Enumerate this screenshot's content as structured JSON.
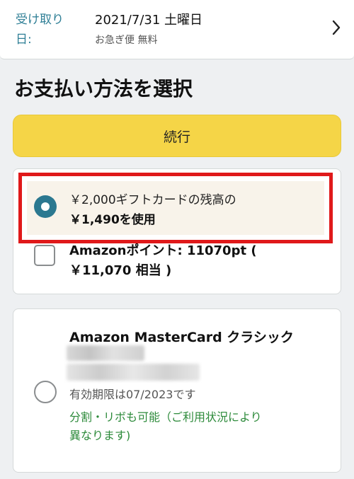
{
  "delivery": {
    "label": "受け取り日:",
    "date": "2021/7/31 土曜日",
    "option": "お急ぎ便 無料"
  },
  "section": {
    "title": "お支払い方法を選択"
  },
  "buttons": {
    "continue": "続行"
  },
  "gift_card": {
    "line1": "￥2,000ギフトカードの残高の",
    "line2": "￥1,490を使用",
    "selected": true
  },
  "points": {
    "line1": "Amazonポイント: 11070pt (",
    "line2": "￥11,070 相当 )",
    "checked": false
  },
  "credit_card": {
    "name": "Amazon MasterCard クラシック",
    "expiry": "有効期限は07/2023です",
    "installment_line1": "分割・リボも可能（ご利用状況により",
    "installment_line2": "異なります)",
    "selected": false
  },
  "colors": {
    "accent_teal": "#2b7890",
    "button_yellow": "#f5d547",
    "highlight_red": "#e0191a",
    "green_text": "#2c8a3a"
  }
}
